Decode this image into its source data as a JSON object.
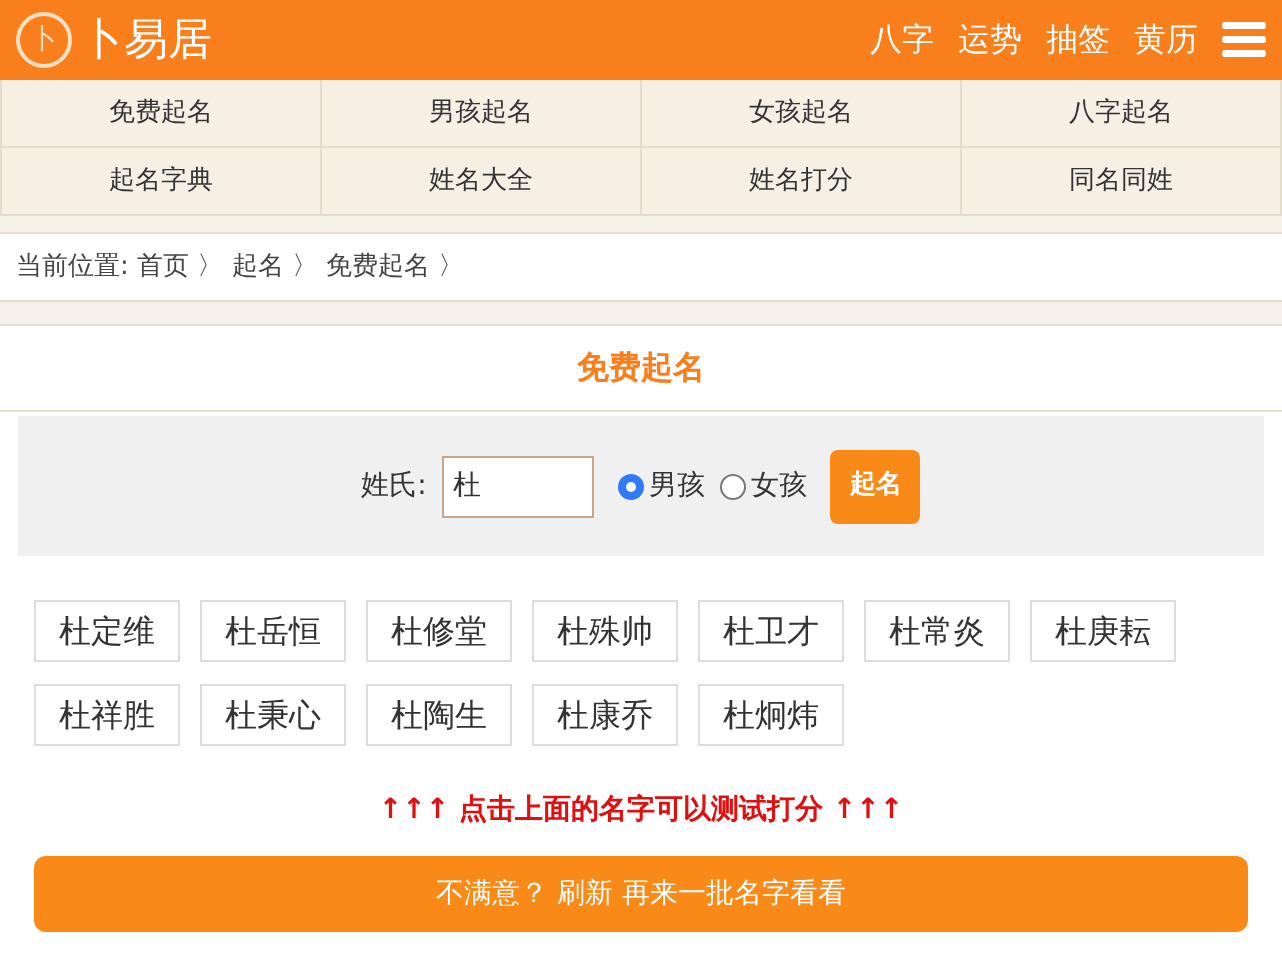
{
  "header": {
    "logo_mark": "卜",
    "logo_text": "卜易居",
    "links": [
      "八字",
      "运势",
      "抽签",
      "黄历"
    ]
  },
  "nav": [
    [
      "免费起名",
      "男孩起名",
      "女孩起名",
      "八字起名"
    ],
    [
      "起名字典",
      "姓名大全",
      "姓名打分",
      "同名同姓"
    ]
  ],
  "breadcrumb": "当前位置: 首页 〉 起名 〉 免费起名 〉",
  "title": "免费起名",
  "form": {
    "label": "姓氏:",
    "value": "杜",
    "genders": [
      {
        "label": "男孩",
        "selected": true
      },
      {
        "label": "女孩",
        "selected": false
      }
    ],
    "submit": "起名"
  },
  "names": [
    "杜定维",
    "杜岳恒",
    "杜修堂",
    "杜殊帅",
    "杜卫才",
    "杜常炎",
    "杜庚耘",
    "杜祥胜",
    "杜秉心",
    "杜陶生",
    "杜康乔",
    "杜炯炜"
  ],
  "hint": "↑↑↑ 点击上面的名字可以测试打分 ↑↑↑",
  "refresh": "不满意？ 刷新 再来一批名字看看"
}
